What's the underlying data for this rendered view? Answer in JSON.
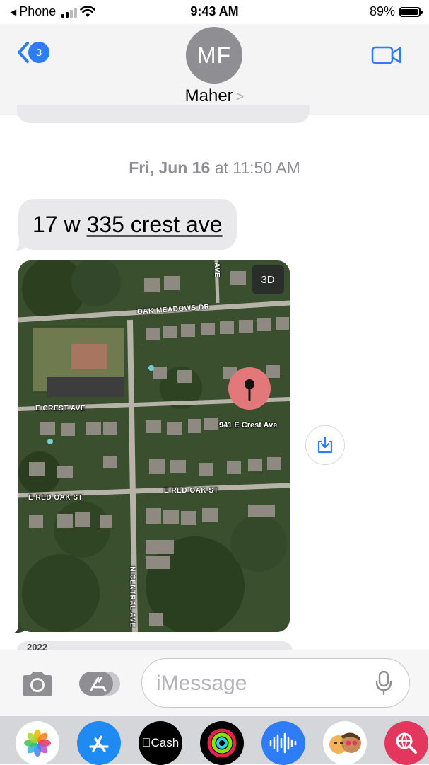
{
  "status_bar": {
    "carrier": "Phone",
    "time": "9:43 AM",
    "battery": "89%",
    "battery_level": 0.89
  },
  "header": {
    "back_count": "3",
    "avatar_initials": "MF",
    "contact_name": "Maher",
    "contact_chevron": ">"
  },
  "conversation": {
    "timestamp_day": "Fri, Jun 16",
    "timestamp_at": "at",
    "timestamp_time": "11:50 AM",
    "message_prefix": "17 w ",
    "message_address": "335 crest ave",
    "map": {
      "button_3d": "3D",
      "pin_label": "941 E Crest Ave",
      "streets": {
        "oak_meadows": "OAK MEADOWS DR",
        "crest_ave": "E CREST AVE",
        "red_oak_left": "E RED OAK ST",
        "red_oak_right": "E RED OAK ST",
        "central_ave": "N CENTRAL AVE",
        "top_ave": "AVE"
      }
    },
    "next_peek_text": "2022"
  },
  "compose": {
    "placeholder": "iMessage"
  },
  "app_drawer": {
    "apps": [
      "Photos",
      "App Store",
      "Cash",
      "Activity",
      "Audio",
      "Memoji",
      "Search"
    ],
    "cash_label": "Cash"
  },
  "colors": {
    "accent": "#2e7cf6",
    "bubble_gray": "#e9e9eb",
    "pin": "#e2787a"
  },
  "icons": [
    "back-chevron-icon",
    "video-camera-icon",
    "camera-icon",
    "app-store-icon",
    "microphone-icon",
    "download-icon",
    "map-pin-icon"
  ]
}
